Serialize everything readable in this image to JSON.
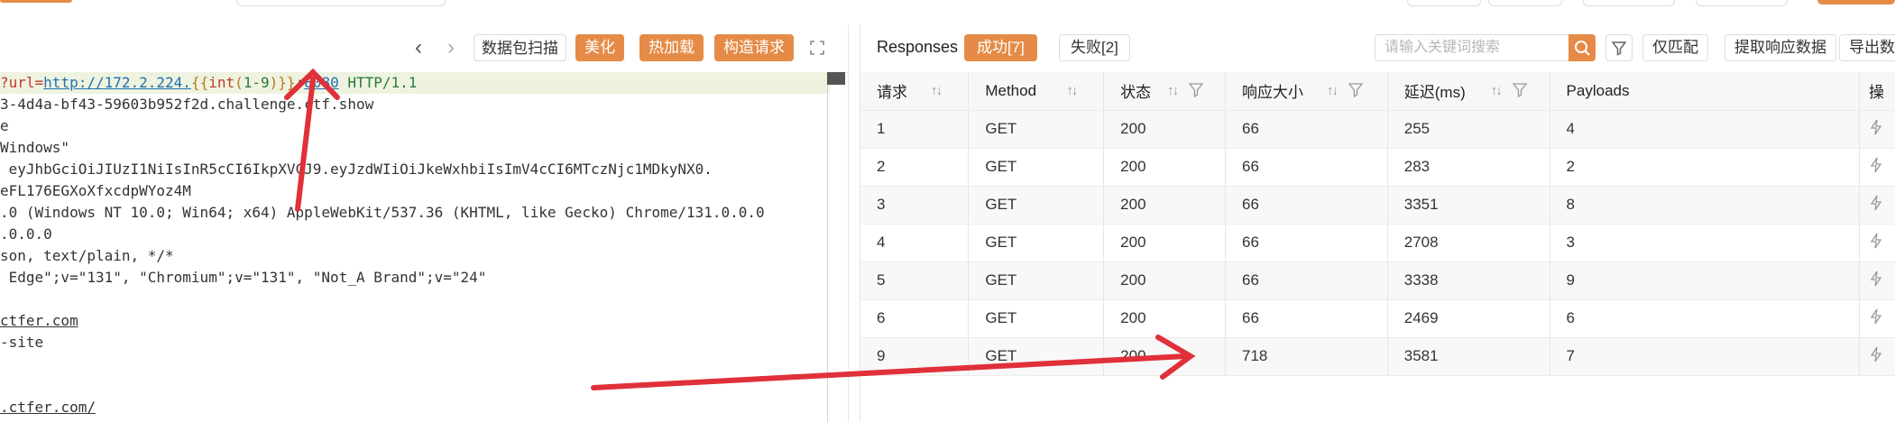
{
  "left_toolbar": {
    "prev_label": "‹",
    "next_label": "›",
    "scan_label": "数据包扫描",
    "beautify_label": "美化",
    "hotload_label": "热加载",
    "construct_label": "构造请求"
  },
  "request_lines": [
    {
      "parts": [
        {
          "t": "?url=",
          "c": "c-red"
        },
        {
          "t": "http://172.2.224.",
          "c": "c-link"
        },
        {
          "t": "{{",
          "c": "c-amber"
        },
        {
          "t": "int",
          "c": "c-red"
        },
        {
          "t": "(",
          "c": "c-amber"
        },
        {
          "t": "1-9",
          "c": "c-green"
        },
        {
          "t": ")}}",
          "c": "c-amber"
        },
        {
          "t": ":",
          "c": ""
        },
        {
          "t": "8080",
          "c": "c-link"
        },
        {
          "t": " HTTP/1.1",
          "c": "c-green"
        }
      ]
    },
    {
      "text": "3-4d4a-bf43-59603b952f2d.challenge.ctf.show"
    },
    {
      "text": "e"
    },
    {
      "text": "Windows\""
    },
    {
      "text": " eyJhbGciOiJIUzI1NiIsInR5cCI6IkpXVCJ9.eyJzdWIiOiJkeWxhbiIsImV4cCI6MTczNjc1MDkyNX0."
    },
    {
      "text": "eFL176EGXoXfxcdpWYoz4M"
    },
    {
      "text": ".0 (Windows NT 10.0; Win64; x64) AppleWebKit/537.36 (KHTML, like Gecko) Chrome/131.0.0.0"
    },
    {
      "text": ".0.0.0"
    },
    {
      "text": "son, text/plain, */*"
    },
    {
      "text": " Edge\";v=\"131\", \"Chromium\";v=\"131\", \"Not_A Brand\";v=\"24\""
    },
    {
      "text": ""
    },
    {
      "text": "ctfer.com",
      "ul": true
    },
    {
      "text": "-site"
    },
    {
      "text": ""
    },
    {
      "text": ""
    },
    {
      "text": ".ctfer.com/",
      "ul": true
    }
  ],
  "right_toolbar": {
    "title": "Responses",
    "success_tab": "成功[7]",
    "fail_tab": "失败[2]",
    "search_placeholder": "请输入关键词搜索",
    "match_only": "仅匹配",
    "extract": "提取响应数据",
    "export": "导出数"
  },
  "table": {
    "headers": [
      "请求",
      "Method",
      "状态",
      "响应大小",
      "延迟(ms)",
      "Payloads",
      "操"
    ],
    "rows": [
      {
        "req": "1",
        "method": "GET",
        "status": "200",
        "size": "66",
        "delay": "255",
        "delay_ok": true,
        "payload": "4"
      },
      {
        "req": "2",
        "method": "GET",
        "status": "200",
        "size": "66",
        "delay": "283",
        "delay_ok": true,
        "payload": "2"
      },
      {
        "req": "3",
        "method": "GET",
        "status": "200",
        "size": "66",
        "delay": "3351",
        "delay_ok": false,
        "payload": "8"
      },
      {
        "req": "4",
        "method": "GET",
        "status": "200",
        "size": "66",
        "delay": "2708",
        "delay_ok": false,
        "payload": "3"
      },
      {
        "req": "5",
        "method": "GET",
        "status": "200",
        "size": "66",
        "delay": "3338",
        "delay_ok": false,
        "payload": "9"
      },
      {
        "req": "6",
        "method": "GET",
        "status": "200",
        "size": "66",
        "delay": "2469",
        "delay_ok": false,
        "payload": "6"
      },
      {
        "req": "9",
        "method": "GET",
        "status": "200",
        "size": "718",
        "delay": "3581",
        "delay_ok": false,
        "payload": "7"
      }
    ]
  },
  "colors": {
    "accent": "#e58b47",
    "status_ok": "#55b16f",
    "delay_slow": "#e0504a",
    "annotation": "#e03039"
  }
}
